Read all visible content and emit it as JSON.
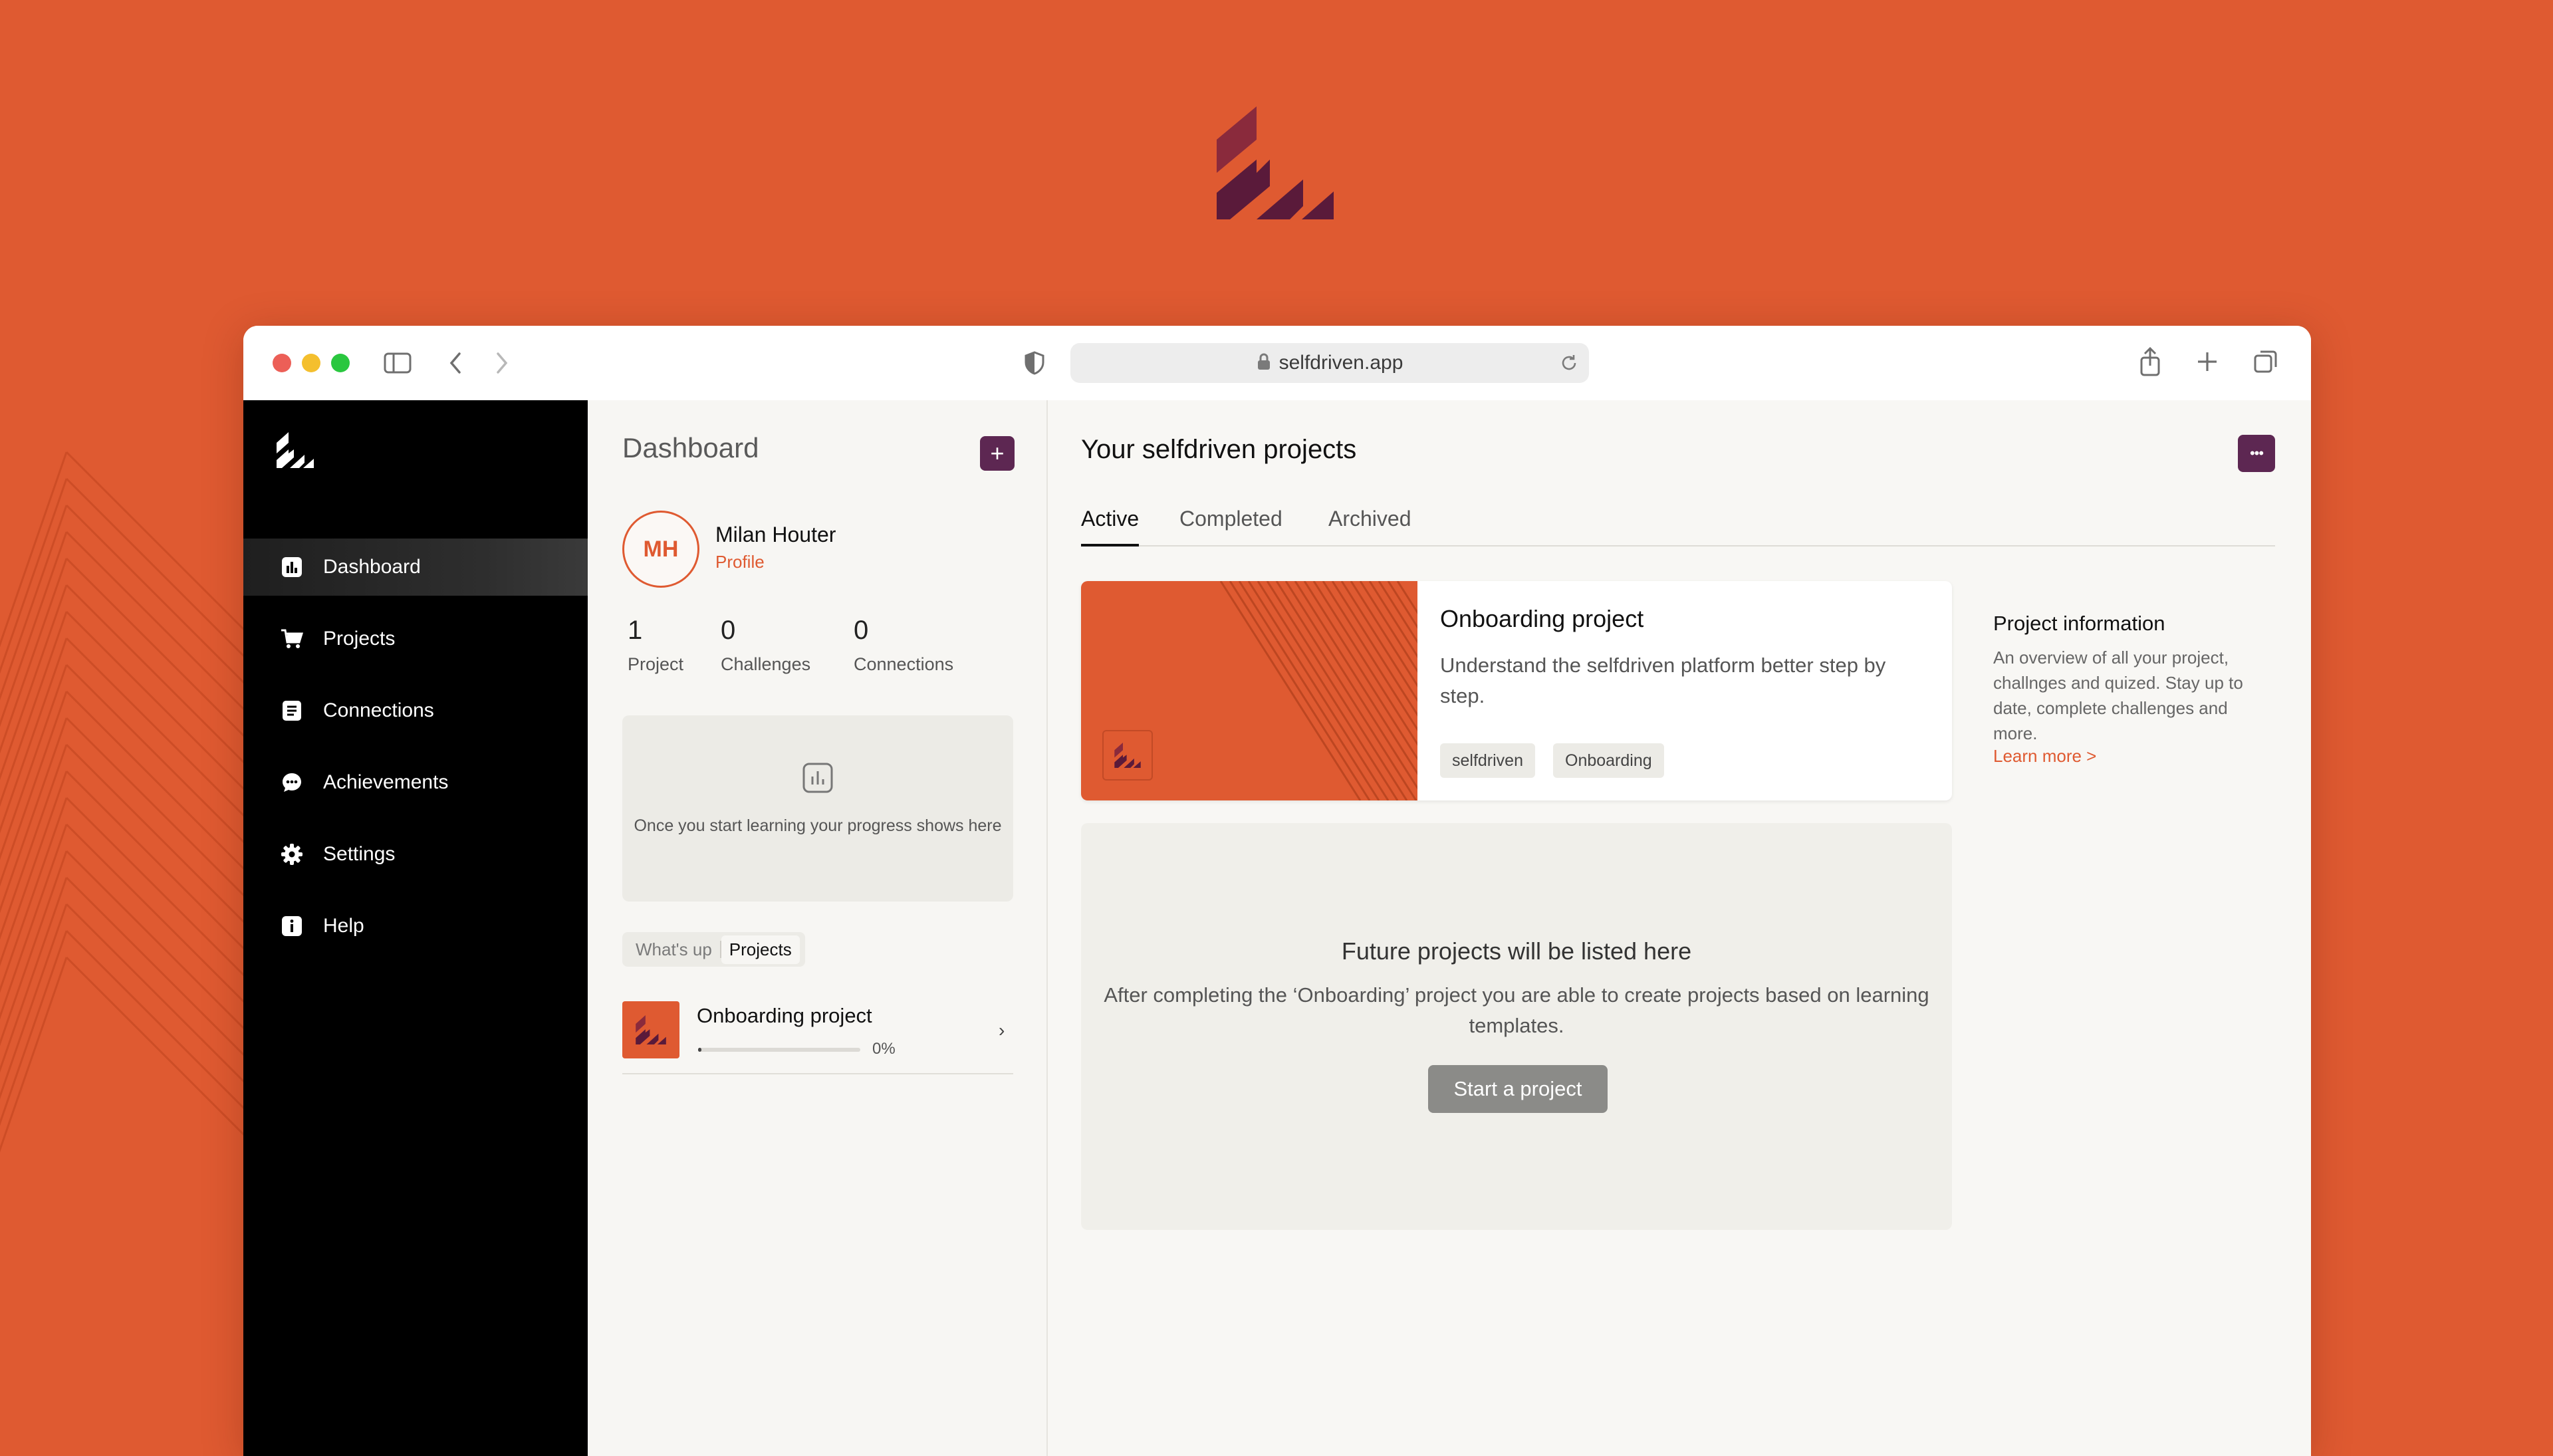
{
  "brand": {
    "accent": "#df5a31",
    "dark_purple": "#5d2752"
  },
  "browser": {
    "url": "selfdriven.app"
  },
  "sidebar": {
    "items": [
      {
        "label": "Dashboard",
        "icon": "bar-chart-icon",
        "active": true
      },
      {
        "label": "Projects",
        "icon": "cart-icon",
        "active": false
      },
      {
        "label": "Connections",
        "icon": "contacts-icon",
        "active": false
      },
      {
        "label": "Achievements",
        "icon": "chat-bubble-icon",
        "active": false
      },
      {
        "label": "Settings",
        "icon": "gear-icon",
        "active": false
      },
      {
        "label": "Help",
        "icon": "info-icon",
        "active": false
      }
    ]
  },
  "dashboard": {
    "title": "Dashboard",
    "add_label": "+",
    "user": {
      "initials": "MH",
      "name": "Milan Houter",
      "profile_label": "Profile"
    },
    "stats": [
      {
        "value": "1",
        "label": "Project"
      },
      {
        "value": "0",
        "label": "Challenges"
      },
      {
        "value": "0",
        "label": "Connections"
      }
    ],
    "progress_empty_text": "Once you start learning your progress shows here",
    "tabs": [
      {
        "label": "What's up",
        "selected": false
      },
      {
        "label": "Projects",
        "selected": true
      }
    ],
    "project": {
      "name": "Onboarding project",
      "progress_text": "0%",
      "progress": 0.02
    }
  },
  "main": {
    "title": "Your selfdriven projects",
    "more_label": "•••",
    "tabs": [
      {
        "label": "Active",
        "selected": true
      },
      {
        "label": "Completed",
        "selected": false
      },
      {
        "label": "Archived",
        "selected": false
      }
    ],
    "card": {
      "title": "Onboarding project",
      "description": "Understand the selfdriven platform better step by step.",
      "tags": [
        "selfdriven",
        "Onboarding"
      ]
    },
    "info": {
      "title": "Project information",
      "description": "An overview of all your project, challnges and quized. Stay up to date, complete challenges and more.",
      "link": "Learn more >"
    },
    "future": {
      "title": "Future projects will be listed here",
      "description": "After completing the ‘Onboarding’ project you are able to create projects based on learning templates.",
      "button": "Start a project"
    }
  }
}
